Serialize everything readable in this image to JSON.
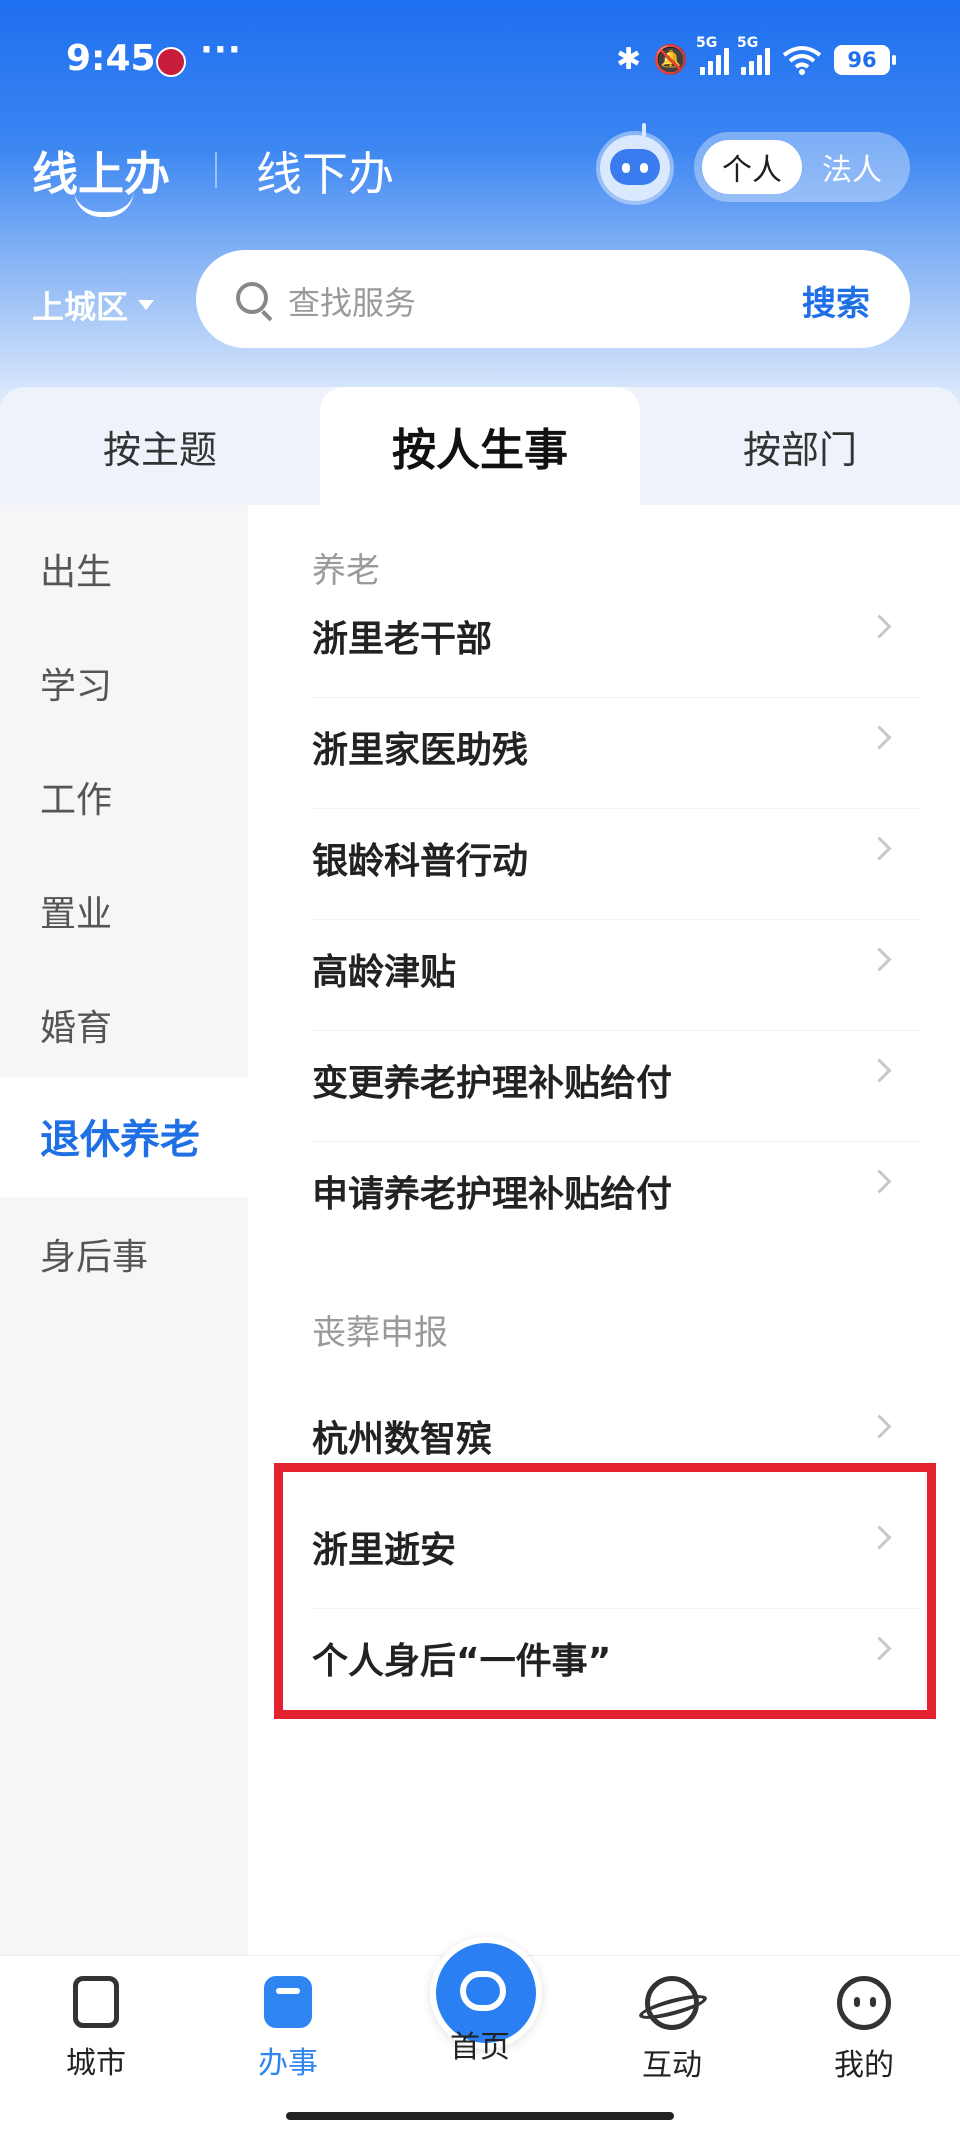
{
  "status_bar": {
    "time": "9:45",
    "more": "···",
    "net1": "5G",
    "net2": "5G",
    "battery": "96"
  },
  "header": {
    "online_label": "线上办",
    "offline_label": "线下办",
    "mode_personal": "个人",
    "mode_legal": "法人"
  },
  "search": {
    "district": "上城区",
    "placeholder": "查找服务",
    "button": "搜索"
  },
  "category_tabs": [
    "按主题",
    "按人生事",
    "按部门"
  ],
  "active_tab": "按人生事",
  "sidebar": {
    "items": [
      "出生",
      "学习",
      "工作",
      "置业",
      "婚育",
      "退休养老",
      "身后事"
    ],
    "active": "退休养老"
  },
  "content": {
    "sections": [
      {
        "title": "养老",
        "items": [
          "浙里老干部",
          "浙里家医助残",
          "银龄科普行动",
          "高龄津贴",
          "变更养老护理补贴给付",
          "申请养老护理补贴给付"
        ]
      },
      {
        "title": "丧葬申报",
        "items": [
          "杭州数智殡",
          "浙里逝安",
          "个人身后“一件事”"
        ]
      }
    ]
  },
  "bottom_nav": {
    "items": [
      "城市",
      "办事",
      "首页",
      "互动",
      "我的"
    ],
    "active": "办事"
  },
  "colors": {
    "brand_blue": "#1f6fe5",
    "highlight_red": "#e4212f"
  }
}
